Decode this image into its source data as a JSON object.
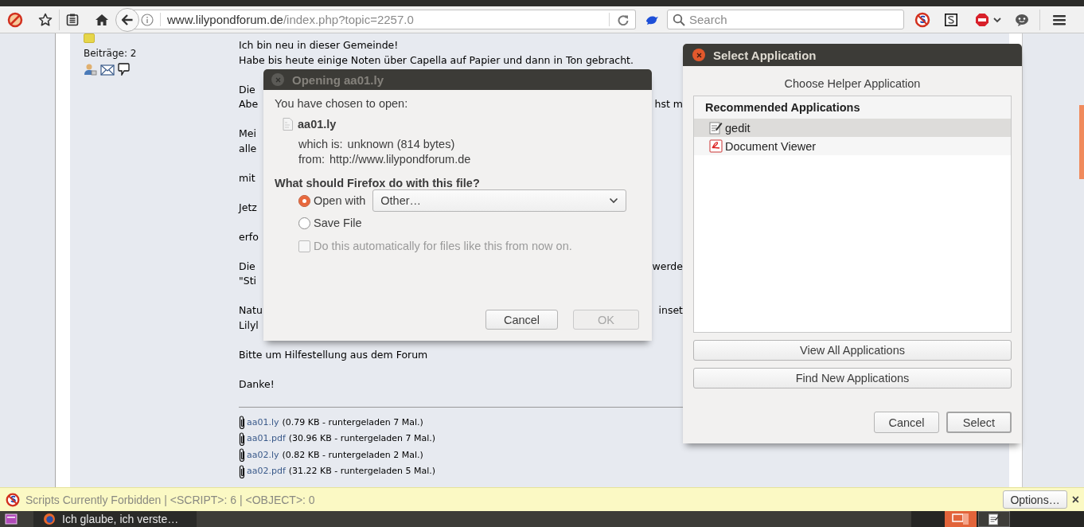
{
  "toolbar": {
    "url_host": "www.lilypondforum.de",
    "url_path": "/index.php?topic=2257.0",
    "search_placeholder": "Search"
  },
  "post": {
    "author": {
      "posts_label": "Beiträge: 2"
    },
    "paragraphs": [
      [
        {
          "text": "Ich bin neu in dieser Gemeinde!"
        },
        {
          "text": "Habe bis heute einige Noten über Capella auf Papier und dann in Ton gebracht."
        }
      ],
      [
        {
          "text": "Die"
        },
        {
          "text": "Abe",
          "right": "hst m"
        }
      ],
      [
        {
          "text": "Mei"
        },
        {
          "text": "alle"
        }
      ],
      [
        {
          "text": "mit"
        }
      ],
      [
        {
          "text": "Jetz"
        }
      ],
      [
        {
          "text": "erfo"
        }
      ],
      [
        {
          "text": "Die",
          "right": "werde"
        },
        {
          "text": "\"Sti"
        }
      ],
      [
        {
          "text": "Natu",
          "right": "inset"
        },
        {
          "text": "Lilyl"
        }
      ],
      [
        {
          "text": "Bitte um Hilfestellung aus dem Forum"
        }
      ],
      [
        {
          "text": "Danke!"
        }
      ]
    ],
    "attachments": [
      {
        "name": "aa01.ly",
        "info": "(0.79 KB - runtergeladen 7 Mal.)"
      },
      {
        "name": "aa01.pdf",
        "info": "(30.96 KB - runtergeladen 7 Mal.)"
      },
      {
        "name": "aa02.ly",
        "info": "(0.82 KB - runtergeladen 2 Mal.)"
      },
      {
        "name": "aa02.pdf",
        "info": "(31.22 KB - runtergeladen 5 Mal.)"
      }
    ]
  },
  "open_dialog": {
    "title": "Opening aa01.ly",
    "active": false,
    "intro": "You have chosen to open:",
    "file_name": "aa01.ly",
    "details": [
      {
        "label": "which is:",
        "value": "unknown (814 bytes)"
      },
      {
        "label": "from:",
        "value": "http://www.lilypondforum.de"
      }
    ],
    "question": "What should Firefox do with this file?",
    "options": [
      {
        "label": "Open with",
        "selected": true,
        "dropdown": "Other…"
      },
      {
        "label": "Save File",
        "selected": false
      }
    ],
    "auto_checkbox": {
      "label": "Do this automatically for files like this from now on.",
      "checked": false,
      "disabled": true
    },
    "buttons": [
      {
        "label": "Cancel",
        "disabled": false
      },
      {
        "label": "OK",
        "disabled": true
      }
    ]
  },
  "select_dialog": {
    "title": "Select Application",
    "active": true,
    "heading": "Choose Helper Application",
    "list_header": "Recommended Applications",
    "applications": [
      {
        "name": "gedit",
        "kind": "editor",
        "selected": true
      },
      {
        "name": "Document Viewer",
        "kind": "viewer",
        "selected": false
      }
    ],
    "wide_buttons": [
      "View All Applications",
      "Find New Applications"
    ],
    "buttons": [
      {
        "label": "Cancel",
        "default": false
      },
      {
        "label": "Select",
        "default": true
      }
    ]
  },
  "notification": {
    "text": "Scripts Currently Forbidden | <SCRIPT>: 6 | <OBJECT>: 0",
    "button": "Options…",
    "close": "×"
  },
  "taskbar": {
    "tasks": [
      {
        "label": "Ich glaube, ich verste…"
      }
    ]
  }
}
